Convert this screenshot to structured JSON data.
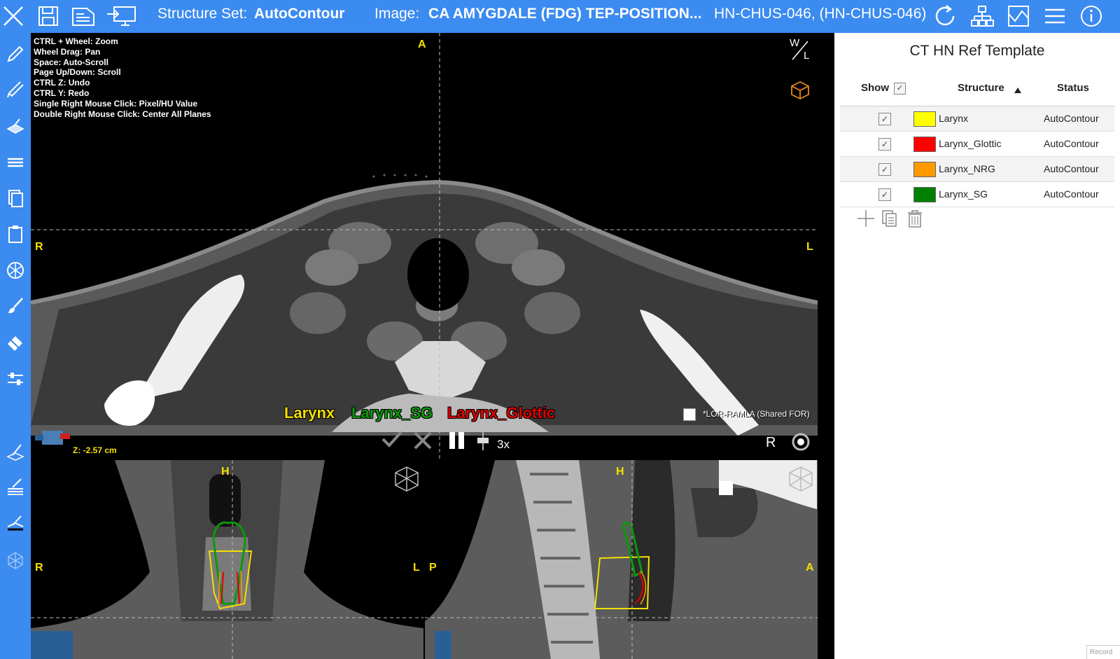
{
  "toolbar": {
    "structure_set_label": "Structure Set:",
    "structure_set_value": "AutoContour",
    "image_label": "Image:",
    "image_value": "CA AMYGDALE (FDG) TEP-POSITION...",
    "patient": "HN-CHUS-046,  (HN-CHUS-046)",
    "icons": [
      "close-icon",
      "save-icon",
      "document-list-icon",
      "monitor-export-icon",
      "refresh-icon",
      "hierarchy-icon",
      "image-window-icon",
      "menu-icon",
      "info-icon"
    ]
  },
  "sidebar": {
    "icons": [
      "pencil-icon",
      "pen-icon",
      "fill-layer-icon",
      "layers-icon",
      "copy-pages-icon",
      "paste-icon",
      "grid-sphere-icon",
      "brush-icon",
      "eraser-icon",
      "sliders-icon",
      "draw-layer-icon",
      "draw-stack-icon",
      "draw-base-icon",
      "cube-wire-icon"
    ]
  },
  "axial": {
    "help_lines": [
      "CTRL + Wheel: Zoom",
      "Wheel Drag: Pan",
      "Space: Auto-Scroll",
      "Page Up/Down: Scroll",
      "CTRL Z: Undo",
      "CTRL Y: Redo",
      "Single Right Mouse Click: Pixel/HU Value",
      "Double Right Mouse Click: Center All Planes"
    ],
    "orient_top": "A",
    "orient_left": "R",
    "orient_right": "L",
    "wl_label_w": "W",
    "wl_label_l": "L",
    "z_value": "Z: -2.57 cm",
    "legend": [
      {
        "name": "Larynx",
        "color": "#f2e000"
      },
      {
        "name": "Larynx_SG",
        "color": "#0a9a0a"
      },
      {
        "name": "Larynx_Glottic",
        "color": "#e00000"
      }
    ],
    "overlay_checkbox_label": "*LOR-RAMLA (Shared FOR)",
    "speed": "3x",
    "orientation_letter": "R"
  },
  "coronal": {
    "orient_top": "H",
    "orient_left": "R",
    "orient_right": "L"
  },
  "sagittal": {
    "orient_top": "H",
    "orient_left": "P",
    "orient_right": "A"
  },
  "panel": {
    "title": "CT HN Ref Template",
    "col_show": "Show",
    "col_structure": "Structure",
    "col_status": "Status",
    "rows": [
      {
        "name": "Larynx",
        "color": "#ffff00",
        "status": "AutoContour",
        "shown": true
      },
      {
        "name": "Larynx_Glottic",
        "color": "#ff0000",
        "status": "AutoContour",
        "shown": true
      },
      {
        "name": "Larynx_NRG",
        "color": "#ff9900",
        "status": "AutoContour",
        "shown": true
      },
      {
        "name": "Larynx_SG",
        "color": "#008000",
        "status": "AutoContour",
        "shown": true
      }
    ],
    "footer_corner": "Record"
  }
}
